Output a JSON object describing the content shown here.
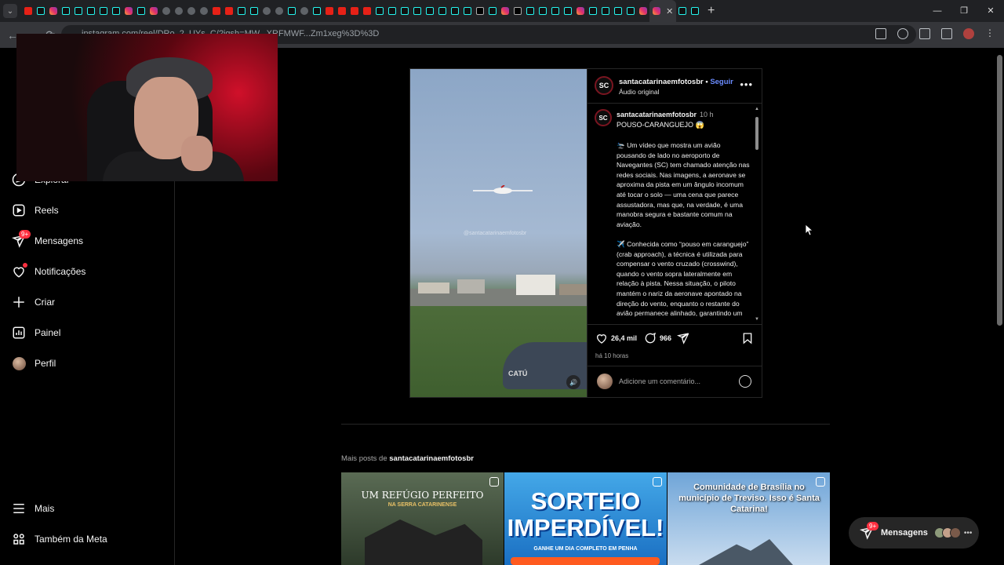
{
  "browser": {
    "url": "instagram.com/reel/DRo_2_UYs_C/?igsh=MW...XRFMWF...Zm1xeg%3D%3D",
    "url_visible": "...Zm1xeg%3D%3D",
    "tab_favicons": [
      "yt",
      "tt",
      "ig",
      "tt",
      "tt",
      "tt",
      "tt",
      "tt",
      "ig",
      "tt",
      "ig",
      "gl",
      "gl",
      "gl",
      "gl",
      "yt",
      "yt",
      "tt",
      "tt",
      "gl",
      "gl",
      "tt",
      "gl",
      "tt",
      "yt",
      "yt",
      "yt",
      "yt",
      "tt",
      "tt",
      "tt",
      "tt",
      "tt",
      "tt",
      "tt",
      "tt",
      "x",
      "tt",
      "ig",
      "x",
      "tt",
      "tt",
      "tt",
      "tt",
      "ig",
      "tt",
      "tt",
      "tt",
      "tt",
      "ig"
    ]
  },
  "sidebar": {
    "items": [
      {
        "id": "explorar",
        "label": "Explorar",
        "icon": "compass-icon"
      },
      {
        "id": "reels",
        "label": "Reels",
        "icon": "reels-icon"
      },
      {
        "id": "mensagens",
        "label": "Mensagens",
        "icon": "messenger-icon",
        "badge": "9+"
      },
      {
        "id": "notificacoes",
        "label": "Notificações",
        "icon": "heart-icon"
      },
      {
        "id": "criar",
        "label": "Criar",
        "icon": "plus-icon"
      },
      {
        "id": "painel",
        "label": "Painel",
        "icon": "chart-icon"
      },
      {
        "id": "perfil",
        "label": "Perfil",
        "icon": "avatar"
      },
      {
        "id": "mais",
        "label": "Mais",
        "icon": "menu-icon"
      },
      {
        "id": "meta",
        "label": "Também da Meta",
        "icon": "meta-icon"
      }
    ]
  },
  "post": {
    "username": "santacatarinaemfotosbr",
    "follow": "Seguir",
    "audio": "Áudio original",
    "logo": "SC",
    "watermark": "@santacatarinaemfotosbr",
    "video_sign": "CATÚ",
    "caption_time": "10 h",
    "caption_title": "POUSO-CARANGUEJO 😱",
    "caption_body": "🛬 Um vídeo que mostra um avião pousando de lado no aeroporto de Navegantes (SC) tem chamado atenção nas redes sociais. Nas imagens, a aeronave se aproxima da pista em um ângulo incomum até tocar o solo — uma cena que parece assustadora, mas que, na verdade, é uma manobra segura e bastante comum na aviação.\n\n✈️ Conhecida como “pouso em caranguejo” (crab approach), a técnica é utilizada para compensar o vento cruzado (crosswind), quando o vento sopra lateralmente em relação à pista. Nessa situação, o piloto mantém o nariz da aeronave apontado na direção do vento, enquanto o restante do avião permanece alinhado, garantindo um",
    "likes": "26,4 mil",
    "comments": "966",
    "posted": "há 10 horas",
    "comment_placeholder": "Adicione um comentário..."
  },
  "more_posts": {
    "prefix": "Mais posts de",
    "username": "santacatarinaemfotosbr",
    "thumbs": [
      {
        "title": "UM REFÚGIO PERFEITO",
        "subtitle": "NA SERRA CATARINENSE"
      },
      {
        "title": "SORTEIO IMPERDÍVEL!",
        "subtitle": "GANHE UM DIA COMPLETO EM PENHA"
      },
      {
        "title": "Comunidade de Brasília no município de Treviso. Isso é Santa Catarina!"
      }
    ]
  },
  "messages_pill": {
    "label": "Mensagens",
    "badge": "9+"
  },
  "colors": {
    "accent_link": "#6b8cff",
    "badge": "#ff3040",
    "bg": "#000000"
  }
}
